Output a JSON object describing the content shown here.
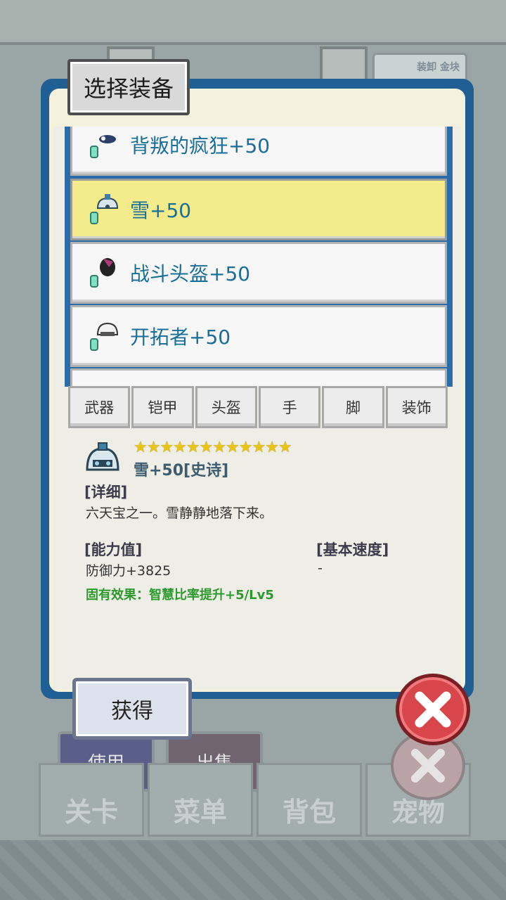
{
  "title": "选择装备",
  "background": {
    "badge": "装卸 金块",
    "dim_buttons": [
      "使用",
      "出售"
    ],
    "nav": [
      "关卡",
      "菜单",
      "背包",
      "宠物"
    ]
  },
  "equipment_list": [
    {
      "name": "背叛的疯狂+50",
      "icon": "sword-icon",
      "selected": false
    },
    {
      "name": "雪+50",
      "icon": "snow-helmet-icon",
      "selected": true
    },
    {
      "name": "战斗头盔+50",
      "icon": "battle-helmet-icon",
      "selected": false
    },
    {
      "name": "开拓者+50",
      "icon": "pioneer-helmet-icon",
      "selected": false
    }
  ],
  "tabs": [
    "武器",
    "铠甲",
    "头盔",
    "手",
    "脚",
    "装饰"
  ],
  "detail": {
    "stars": "★★★★★★★★★★★★",
    "star_count": 12,
    "item_name": "雪+50[史诗]",
    "detail_label": "[详细]",
    "description": "六天宝之一。雪静静地落下来。",
    "ability_label": "[能力值]",
    "ability_value": "防御力+3825",
    "speed_label": "[基本速度]",
    "speed_value": "-",
    "effect": "固有效果：智慧比率提升+5/Lv5"
  },
  "get_button": "获得",
  "colors": {
    "frame_blue": "#1f5f93",
    "selected_yellow": "#f4ec8a",
    "item_text": "#1a6f98",
    "effect_green": "#2c9a2c",
    "close_red": "#d8454a"
  }
}
